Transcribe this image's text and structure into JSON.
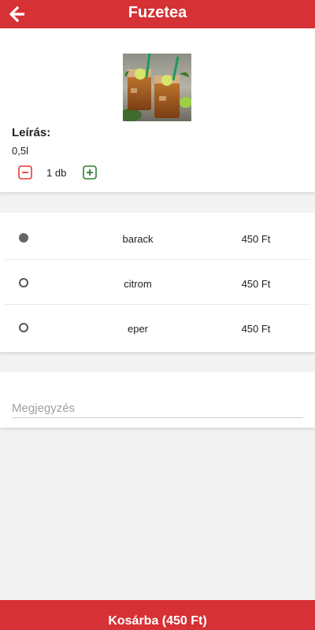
{
  "header": {
    "title": "Fuzetea",
    "back_icon": "arrow-left-icon"
  },
  "product": {
    "image_alt": "Fuzetea drinks",
    "description_label": "Leírás:",
    "description_value": "0,5l",
    "quantity_display": "1 db",
    "minus_icon": "minus-square-icon",
    "plus_icon": "plus-square-icon"
  },
  "variants": [
    {
      "name": "barack",
      "price": "450 Ft",
      "selected": true
    },
    {
      "name": "citrom",
      "price": "450 Ft",
      "selected": false
    },
    {
      "name": "eper",
      "price": "450 Ft",
      "selected": false
    }
  ],
  "note": {
    "placeholder": "Megjegyzés",
    "value": ""
  },
  "cart": {
    "label": "Kosárba (450 Ft)"
  },
  "colors": {
    "brand_red": "#d63135",
    "minus_red": "#e53935",
    "plus_green": "#2e7d32",
    "background": "#f3f3f3"
  }
}
